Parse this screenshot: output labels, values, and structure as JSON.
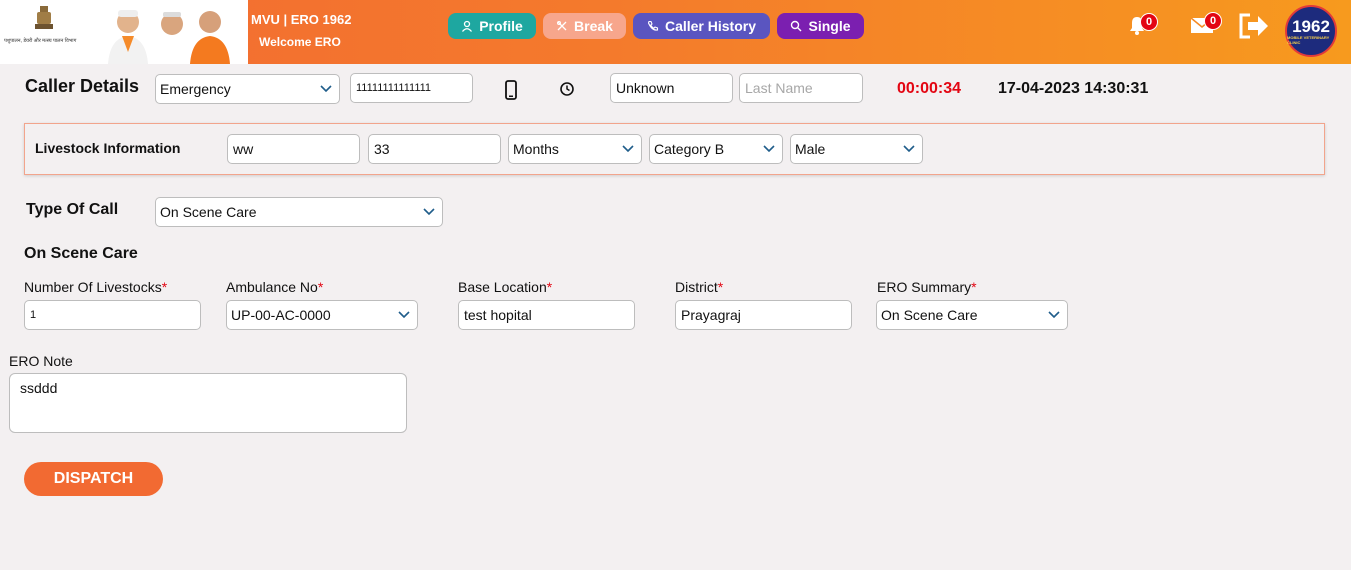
{
  "header": {
    "app_title": "MVU | ERO 1962",
    "welcome": "Welcome ERO",
    "logo_text": "पशुपालन, डेयरी और मत्स्य पालन विभाग",
    "buttons": {
      "profile": "Profile",
      "break": "Break",
      "caller_history": "Caller History",
      "single": "Single"
    },
    "notifications_count": "0",
    "messages_count": "0",
    "brand": {
      "number": "1962",
      "caption": "MOBILE VETERINARY CLINIC"
    },
    "colors": {
      "profile": "#1ea7a0",
      "break": "#f7a68c",
      "history": "#5a55c0",
      "single": "#7b1fb0",
      "badge": "#e30613"
    }
  },
  "caller": {
    "section_label": "Caller Details",
    "call_type": "Emergency",
    "phone": "11111111111111",
    "first_name": "Unknown",
    "last_name_placeholder": "Last Name",
    "timer": "00:00:34",
    "datetime": "17-04-2023 14:30:31"
  },
  "livestock": {
    "section_label": "Livestock Information",
    "name": "ww",
    "age": "33",
    "age_unit": "Months",
    "category": "Category B",
    "gender": "Male"
  },
  "type_of_call": {
    "label": "Type Of Call",
    "value": "On Scene Care"
  },
  "on_scene": {
    "title": "On Scene Care",
    "fields": {
      "num_livestocks": {
        "label": "Number Of Livestocks",
        "value": "1"
      },
      "ambulance_no": {
        "label": "Ambulance No",
        "value": "UP-00-AC-0000"
      },
      "base_location": {
        "label": "Base Location",
        "value": "test hopital"
      },
      "district": {
        "label": "District",
        "value": "Prayagraj"
      },
      "ero_summary": {
        "label": "ERO Summary",
        "value": "On Scene Care"
      }
    },
    "required_mark": "*",
    "ero_note": {
      "label": "ERO Note",
      "value": "ssddd"
    }
  },
  "actions": {
    "dispatch": "DISPATCH"
  }
}
